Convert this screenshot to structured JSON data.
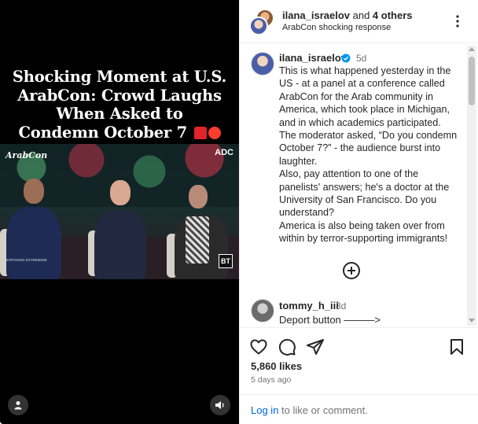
{
  "media": {
    "headline": [
      "Shocking Moment at U.S.",
      "ArabCon: Crowd Laughs",
      "When Asked to",
      "Condemn October 7"
    ],
    "frame_logo_left": "ArabCon",
    "frame_logo_right": "ADC",
    "frame_watermark": "EXPOSING EXTREMISM",
    "frame_badge": "BT"
  },
  "header": {
    "username": "ilana_israelov",
    "and_others": " and ",
    "others": "4 others",
    "subtitle": "ArabCon shocking response"
  },
  "caption": {
    "username": "ilana_israelov",
    "time": "5d",
    "paragraphs": [
      "This is what happened yesterday in the US - at a panel at a conference called ArabCon for the Arab community in America, which took place in Michigan, and in which academics participated.",
      "The moderator asked, “Do you condemn October 7?” - the audience burst into laughter.",
      "Also, pay attention to one of the panelists' answers; he's a doctor at the University of San Francisco. Do you understand?",
      "America is also being taken over from within by terror-supporting immigrants!"
    ]
  },
  "comment": {
    "username": "tommy_h_iii",
    "time": "3d",
    "text": "Deport button ———>"
  },
  "stats": {
    "likes": "5,860 likes",
    "date": "5 days ago"
  },
  "login": {
    "link": "Log in",
    "rest": " to like or comment."
  },
  "icons": [
    "user-icon",
    "volume-icon",
    "more-options-icon",
    "verified-badge-icon",
    "load-more-icon",
    "heart-icon",
    "comment-icon",
    "share-icon",
    "bookmark-icon"
  ]
}
